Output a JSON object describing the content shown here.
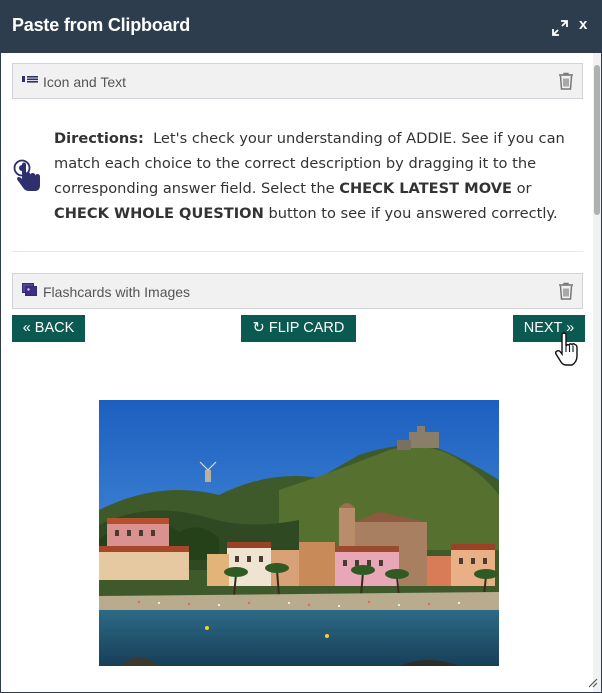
{
  "dialog": {
    "title": "Paste from Clipboard",
    "close_label": "x",
    "expand_icon": "expand-arrows-icon"
  },
  "blocks": [
    {
      "label": "Icon and Text",
      "icon": "icon-text-block-icon",
      "action_icon": "trash-icon"
    },
    {
      "label": "Flashcards with Images",
      "icon": "flashcards-icon",
      "action_icon": "trash-icon"
    }
  ],
  "directions": {
    "heading": "Directions:",
    "text_1": "Let's check your understanding of ADDIE. See if you can match each choice to the correct description by dragging it to the corresponding answer field. Select the",
    "bold_1": "CHECK LATEST MOVE",
    "text_2": "or",
    "bold_2": "CHECK WHOLE QUESTION",
    "text_3": "button to see if you answered correctly.",
    "icon": "pointing-hand-icon"
  },
  "flashcard_controls": {
    "back_label": "« BACK",
    "flip_label": "FLIP CARD",
    "flip_icon": "refresh-icon",
    "next_label": "NEXT »"
  },
  "flashcard_image": {
    "description_icon": "seaside-town-photo"
  },
  "colors": {
    "titlebar": "#2e3d4d",
    "button": "#0b5a52",
    "icon_navy": "#2d2f6e"
  }
}
